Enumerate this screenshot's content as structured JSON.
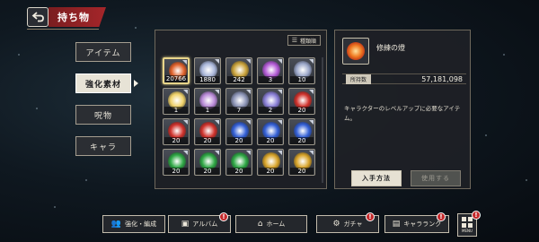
{
  "header": {
    "title": "持ち物",
    "back_icon": "back-arrow-icon"
  },
  "tabs": [
    {
      "label": "アイテム",
      "active": false
    },
    {
      "label": "強化素材",
      "active": true
    },
    {
      "label": "呪物",
      "active": false
    },
    {
      "label": "キャラ",
      "active": false
    }
  ],
  "grid": {
    "sort_label": "種類順",
    "sort_icon": "sort-list-icon",
    "items": [
      {
        "qty": "20766",
        "color": "#e0612a",
        "selected": true
      },
      {
        "qty": "1880",
        "color": "#a9b6d9"
      },
      {
        "qty": "242",
        "color": "#c9a23a"
      },
      {
        "qty": "3",
        "color": "#b25ad4"
      },
      {
        "qty": "10",
        "color": "#9aa6c8"
      },
      {
        "qty": "1",
        "color": "#f0d26a"
      },
      {
        "qty": "1",
        "color": "#b98ad8"
      },
      {
        "qty": "7",
        "color": "#8e96b8"
      },
      {
        "qty": "2",
        "color": "#8a7fd6"
      },
      {
        "qty": "20",
        "color": "#d0322c"
      },
      {
        "qty": "20",
        "color": "#d0322c"
      },
      {
        "qty": "20",
        "color": "#d0322c"
      },
      {
        "qty": "20",
        "color": "#3460d6"
      },
      {
        "qty": "20",
        "color": "#3460d6"
      },
      {
        "qty": "20",
        "color": "#3460d6"
      },
      {
        "qty": "20",
        "color": "#2fa845"
      },
      {
        "qty": "20",
        "color": "#2fa845"
      },
      {
        "qty": "20",
        "color": "#2fa845"
      },
      {
        "qty": "20",
        "color": "#d8a42a"
      },
      {
        "qty": "20",
        "color": "#d8a42a"
      }
    ]
  },
  "detail": {
    "name": "修練の燈",
    "owned_label": "所持数",
    "owned_value": "57,181,098",
    "description": "キャラクターのレベルアップに必要なアイテム。",
    "obtain_button": "入手方法",
    "use_button": "使用する"
  },
  "bottom_nav": [
    {
      "label": "強化・編成",
      "icon": "people-icon",
      "badge": ""
    },
    {
      "label": "アルバム",
      "icon": "album-icon",
      "badge": "!"
    },
    {
      "label": "ホーム",
      "icon": "home-icon",
      "badge": ""
    },
    {
      "label": "ガチャ",
      "icon": "gacha-icon",
      "badge": "!"
    },
    {
      "label": "キャラランク",
      "icon": "rank-icon",
      "badge": "!"
    }
  ],
  "menu": {
    "label": "MENU",
    "badge": "!"
  },
  "colors": {
    "accent_red": "#a5262a",
    "badge_red": "#c3282a",
    "panel_border": "#6e685c"
  }
}
